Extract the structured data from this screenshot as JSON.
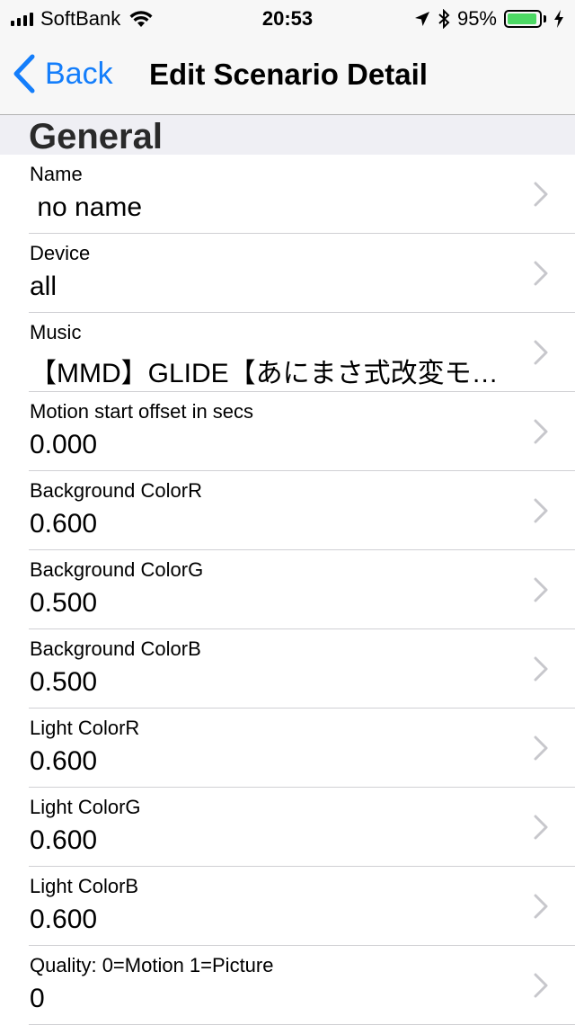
{
  "status_bar": {
    "carrier": "SoftBank",
    "time": "20:53",
    "battery_percent": "95%",
    "battery_level": 0.95,
    "battery_color": "#4cd964"
  },
  "nav": {
    "back_label": "Back",
    "title": "Edit Scenario Detail",
    "accent_color": "#147efb"
  },
  "section": {
    "title": "General"
  },
  "rows": [
    {
      "label": "Name",
      "value": " no name"
    },
    {
      "label": "Device",
      "value": "all"
    },
    {
      "label": "Music",
      "value": "【MMD】GLIDE【あにまさ式改変モ…"
    },
    {
      "label": "Motion start offset in secs",
      "value": "0.000"
    },
    {
      "label": "Background ColorR",
      "value": "0.600"
    },
    {
      "label": "Background ColorG",
      "value": "0.500"
    },
    {
      "label": "Background ColorB",
      "value": "0.500"
    },
    {
      "label": "Light ColorR",
      "value": "0.600"
    },
    {
      "label": "Light ColorG",
      "value": "0.600"
    },
    {
      "label": "Light ColorB",
      "value": "0.600"
    },
    {
      "label": "Quality: 0=Motion 1=Picture",
      "value": "0"
    }
  ]
}
